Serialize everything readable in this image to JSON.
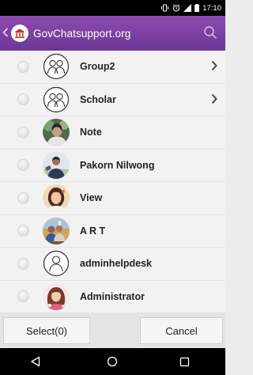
{
  "status_bar": {
    "time": "17:10",
    "icons": [
      "vibrate-icon",
      "alarm-icon",
      "signal-icon",
      "battery-icon"
    ]
  },
  "app_bar": {
    "title": "GovChatsupport.org",
    "icons": [
      "back-icon",
      "government-logo-icon",
      "search-icon"
    ]
  },
  "contacts": [
    {
      "name": "Group2",
      "avatar": "group-default-icon",
      "has_chevron": true
    },
    {
      "name": "Scholar",
      "avatar": "group-default-icon",
      "has_chevron": true
    },
    {
      "name": "Note",
      "avatar": "photo",
      "has_chevron": false
    },
    {
      "name": "Pakorn Nilwong",
      "avatar": "photo",
      "has_chevron": false
    },
    {
      "name": "View",
      "avatar": "photo",
      "has_chevron": false
    },
    {
      "name": "A R T",
      "avatar": "photo",
      "has_chevron": false
    },
    {
      "name": "adminhelpdesk",
      "avatar": "user-default-icon",
      "has_chevron": false
    },
    {
      "name": "Administrator",
      "avatar": "photo",
      "has_chevron": false
    }
  ],
  "actions": {
    "select_label": "Select(0)",
    "cancel_label": "Cancel"
  },
  "nav_bar": {
    "icons": [
      "back-triangle-icon",
      "home-circle-icon",
      "recents-square-icon"
    ]
  },
  "colors": {
    "app_bar": "#7a40a2",
    "list_background": "#f2f2f2",
    "status_bar": "#000000"
  }
}
